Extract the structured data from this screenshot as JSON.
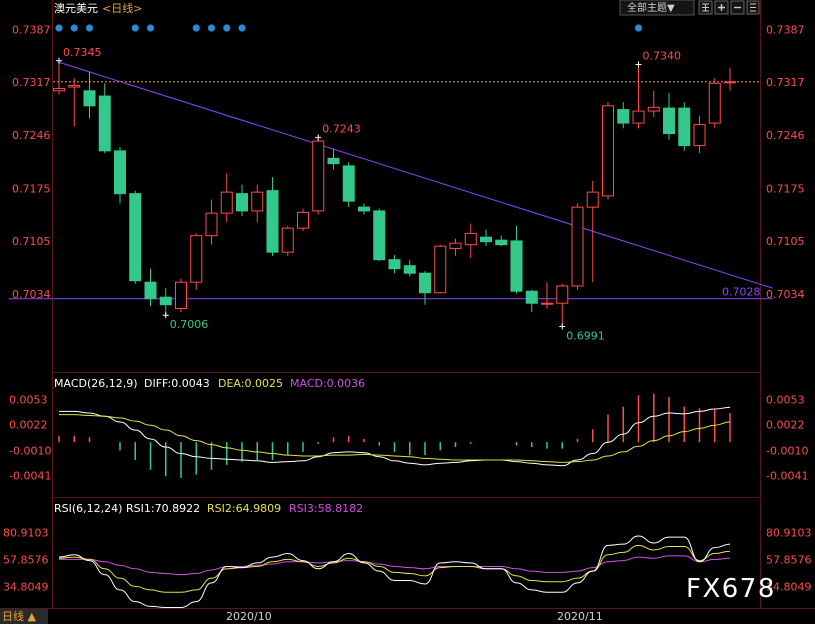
{
  "header": {
    "title": "澳元美元",
    "period": "<日线>",
    "theme_button": "全部主题▼",
    "toolbar_icons": [
      "grid-icon",
      "add-icon",
      "subtract-icon",
      "list-icon",
      "more-icon"
    ]
  },
  "colors": {
    "up": "#ff4b4b",
    "down": "#34c98c",
    "trend": "#8a44ff",
    "dot": "#2b8ad8",
    "diff": "#ffffff",
    "dea": "#e6e04a",
    "macd_label": "#d050e0",
    "rsi1": "#ffffff",
    "rsi2": "#e6e04a",
    "rsi3": "#d050e0"
  },
  "chart_data": [
    {
      "type": "candlestick",
      "title": "澳元美元<日线>",
      "ylim": [
        0.6965,
        0.7402
      ],
      "y_ticks": [
        "0.7387",
        "0.7317",
        "0.7246",
        "0.7175",
        "0.7105",
        "0.7034"
      ],
      "right_axis_ticks": [
        "0.7387",
        "0.7317",
        "0.7246",
        "0.7175",
        "0.7105",
        "0.7034"
      ],
      "last_price": "0.7317",
      "candles": [
        {
          "o": 0.7305,
          "h": 0.7345,
          "l": 0.73,
          "c": 0.7308
        },
        {
          "o": 0.731,
          "h": 0.7322,
          "l": 0.7258,
          "c": 0.7312
        },
        {
          "o": 0.7305,
          "h": 0.733,
          "l": 0.7268,
          "c": 0.7285
        },
        {
          "o": 0.7298,
          "h": 0.7315,
          "l": 0.7222,
          "c": 0.7225
        },
        {
          "o": 0.7225,
          "h": 0.723,
          "l": 0.7155,
          "c": 0.7168
        },
        {
          "o": 0.7168,
          "h": 0.7172,
          "l": 0.7048,
          "c": 0.7052
        },
        {
          "o": 0.705,
          "h": 0.7068,
          "l": 0.7018,
          "c": 0.7028
        },
        {
          "o": 0.703,
          "h": 0.7042,
          "l": 0.7006,
          "c": 0.702
        },
        {
          "o": 0.7015,
          "h": 0.7055,
          "l": 0.701,
          "c": 0.705
        },
        {
          "o": 0.705,
          "h": 0.7115,
          "l": 0.704,
          "c": 0.7112
        },
        {
          "o": 0.7112,
          "h": 0.716,
          "l": 0.71,
          "c": 0.7142
        },
        {
          "o": 0.7142,
          "h": 0.7195,
          "l": 0.713,
          "c": 0.717
        },
        {
          "o": 0.7168,
          "h": 0.718,
          "l": 0.7138,
          "c": 0.7145
        },
        {
          "o": 0.7145,
          "h": 0.718,
          "l": 0.713,
          "c": 0.717
        },
        {
          "o": 0.7172,
          "h": 0.719,
          "l": 0.7085,
          "c": 0.709
        },
        {
          "o": 0.709,
          "h": 0.7125,
          "l": 0.7085,
          "c": 0.7122
        },
        {
          "o": 0.7122,
          "h": 0.7148,
          "l": 0.7118,
          "c": 0.7143
        },
        {
          "o": 0.7145,
          "h": 0.7243,
          "l": 0.714,
          "c": 0.7238
        },
        {
          "o": 0.7215,
          "h": 0.7228,
          "l": 0.72,
          "c": 0.7208
        },
        {
          "o": 0.7205,
          "h": 0.721,
          "l": 0.715,
          "c": 0.7158
        },
        {
          "o": 0.715,
          "h": 0.7155,
          "l": 0.714,
          "c": 0.7145
        },
        {
          "o": 0.7145,
          "h": 0.7148,
          "l": 0.7078,
          "c": 0.708
        },
        {
          "o": 0.708,
          "h": 0.7086,
          "l": 0.7062,
          "c": 0.7068
        },
        {
          "o": 0.7072,
          "h": 0.708,
          "l": 0.7058,
          "c": 0.7062
        },
        {
          "o": 0.7062,
          "h": 0.7065,
          "l": 0.702,
          "c": 0.7036
        },
        {
          "o": 0.7036,
          "h": 0.71,
          "l": 0.7035,
          "c": 0.7098
        },
        {
          "o": 0.7095,
          "h": 0.7108,
          "l": 0.7085,
          "c": 0.7102
        },
        {
          "o": 0.71,
          "h": 0.7128,
          "l": 0.7082,
          "c": 0.7115
        },
        {
          "o": 0.711,
          "h": 0.712,
          "l": 0.7098,
          "c": 0.7104
        },
        {
          "o": 0.7106,
          "h": 0.7112,
          "l": 0.7098,
          "c": 0.71
        },
        {
          "o": 0.7105,
          "h": 0.7125,
          "l": 0.7035,
          "c": 0.7038
        },
        {
          "o": 0.7038,
          "h": 0.704,
          "l": 0.701,
          "c": 0.7022
        },
        {
          "o": 0.7022,
          "h": 0.705,
          "l": 0.7015,
          "c": 0.7022
        },
        {
          "o": 0.7022,
          "h": 0.7048,
          "l": 0.6991,
          "c": 0.7045
        },
        {
          "o": 0.7045,
          "h": 0.7155,
          "l": 0.704,
          "c": 0.715
        },
        {
          "o": 0.715,
          "h": 0.7185,
          "l": 0.705,
          "c": 0.717
        },
        {
          "o": 0.7165,
          "h": 0.729,
          "l": 0.716,
          "c": 0.7285
        },
        {
          "o": 0.728,
          "h": 0.729,
          "l": 0.7255,
          "c": 0.7262
        },
        {
          "o": 0.7262,
          "h": 0.734,
          "l": 0.7255,
          "c": 0.7278
        },
        {
          "o": 0.7278,
          "h": 0.7305,
          "l": 0.727,
          "c": 0.7283
        },
        {
          "o": 0.7282,
          "h": 0.7302,
          "l": 0.724,
          "c": 0.7248
        },
        {
          "o": 0.7282,
          "h": 0.729,
          "l": 0.7225,
          "c": 0.7232
        },
        {
          "o": 0.7232,
          "h": 0.7272,
          "l": 0.7222,
          "c": 0.726
        },
        {
          "o": 0.7262,
          "h": 0.7322,
          "l": 0.7255,
          "c": 0.7315
        },
        {
          "o": 0.7317,
          "h": 0.7335,
          "l": 0.7305,
          "c": 0.7317
        }
      ],
      "annotations": [
        {
          "label": "0.7345",
          "index": 0,
          "value": 0.7345,
          "kind": "high"
        },
        {
          "label": "0.7006",
          "index": 7,
          "value": 0.7006,
          "kind": "low"
        },
        {
          "label": "0.7243",
          "index": 17,
          "value": 0.7243,
          "kind": "high"
        },
        {
          "label": "0.6991",
          "index": 33,
          "value": 0.6991,
          "kind": "low"
        },
        {
          "label": "0.7340",
          "index": 38,
          "value": 0.734,
          "kind": "high"
        }
      ],
      "trendlines": [
        {
          "from": [
            0,
            0.7343
          ],
          "to": [
            46.8,
            0.7042
          ]
        },
        {
          "from": [
            -3.3,
            0.7028
          ],
          "to": [
            46.8,
            0.7028
          ],
          "label": "0.7028"
        }
      ],
      "signal_dot_indices": [
        0,
        1,
        2,
        5,
        6,
        9,
        10,
        11,
        12,
        38
      ]
    },
    {
      "type": "line",
      "title": "MACD(26,12,9)",
      "legend": [
        {
          "label": "DIFF:0.0043",
          "color_key": "diff"
        },
        {
          "label": "DEA:0.0025",
          "color_key": "dea"
        },
        {
          "label": "MACD:0.0036",
          "color_key": "macd_label"
        }
      ],
      "ylim": [
        -0.0064,
        0.0062
      ],
      "y_ticks": [
        "0.0053",
        "0.0022",
        "-0.0010",
        "-0.0041"
      ],
      "series": [
        {
          "color_key": "diff",
          "values": [
            0.0038,
            0.0038,
            0.0036,
            0.0032,
            0.0025,
            0.0015,
            0.0004,
            -0.0006,
            -0.0014,
            -0.0018,
            -0.002,
            -0.0021,
            -0.0022,
            -0.0023,
            -0.0025,
            -0.0024,
            -0.0023,
            -0.0018,
            -0.0013,
            -0.0012,
            -0.0013,
            -0.0018,
            -0.0023,
            -0.0026,
            -0.0028,
            -0.0026,
            -0.0025,
            -0.0023,
            -0.0022,
            -0.0022,
            -0.0024,
            -0.0026,
            -0.0028,
            -0.0029,
            -0.0022,
            -0.0014,
            0.0,
            0.001,
            0.0024,
            0.0032,
            0.0036,
            0.0035,
            0.0038,
            0.0041,
            0.0043
          ]
        },
        {
          "color_key": "dea",
          "values": [
            0.0034,
            0.0034,
            0.0033,
            0.0032,
            0.003,
            0.0026,
            0.0021,
            0.0015,
            0.0008,
            0.0002,
            -0.0003,
            -0.0007,
            -0.001,
            -0.0012,
            -0.0014,
            -0.0016,
            -0.0017,
            -0.0017,
            -0.0016,
            -0.0016,
            -0.0015,
            -0.0016,
            -0.0017,
            -0.0018,
            -0.002,
            -0.0021,
            -0.0022,
            -0.0022,
            -0.0022,
            -0.0022,
            -0.0022,
            -0.0023,
            -0.0024,
            -0.0025,
            -0.0024,
            -0.0022,
            -0.0017,
            -0.0012,
            -0.0005,
            0.0002,
            0.0008,
            0.0013,
            0.0017,
            0.0021,
            0.0025
          ]
        },
        {
          "name": "MACD",
          "type": "bar",
          "values": [
            0.0008,
            0.0008,
            0.0006,
            0.0,
            -0.001,
            -0.0022,
            -0.0034,
            -0.0042,
            -0.0044,
            -0.004,
            -0.0034,
            -0.0028,
            -0.0024,
            -0.0022,
            -0.0022,
            -0.0016,
            -0.0012,
            -0.0002,
            0.0006,
            0.0008,
            0.0004,
            -0.0004,
            -0.0012,
            -0.0016,
            -0.0016,
            -0.001,
            -0.0006,
            -0.0002,
            0.0,
            0.0,
            -0.0004,
            -0.0006,
            -0.0008,
            -0.0008,
            0.0004,
            0.0016,
            0.0034,
            0.0044,
            0.0058,
            0.006,
            0.0056,
            0.0044,
            0.0042,
            0.004,
            0.0036
          ]
        }
      ]
    },
    {
      "type": "line",
      "title": "RSI(6,12,24)",
      "legend": [
        {
          "label": "RSI1:70.8922",
          "color_key": "rsi1"
        },
        {
          "label": "RSI2:64.9809",
          "color_key": "rsi2"
        },
        {
          "label": "RSI3:58.8182",
          "color_key": "rsi3"
        }
      ],
      "ylim": [
        20,
        95
      ],
      "y_ticks": [
        "80.9103",
        "57.8576",
        "34.8049"
      ],
      "series": [
        {
          "color_key": "rsi1",
          "values": [
            60,
            62,
            57,
            45,
            32,
            22,
            18,
            17,
            17,
            22,
            38,
            52,
            51,
            55,
            60,
            63,
            57,
            50,
            56,
            63,
            55,
            48,
            40,
            40,
            37,
            55,
            56,
            55,
            50,
            50,
            38,
            32,
            30,
            30,
            38,
            48,
            70,
            71,
            78,
            72,
            77,
            77,
            56,
            68,
            71
          ]
        },
        {
          "color_key": "rsi2",
          "values": [
            59,
            60,
            58,
            50,
            42,
            35,
            32,
            30,
            30,
            32,
            42,
            50,
            51,
            52,
            56,
            58,
            56,
            52,
            55,
            59,
            56,
            52,
            47,
            46,
            44,
            51,
            52,
            52,
            50,
            50,
            44,
            40,
            39,
            39,
            42,
            48,
            62,
            64,
            70,
            66,
            69,
            69,
            57,
            63,
            65
          ]
        },
        {
          "color_key": "rsi3",
          "values": [
            58,
            58,
            58,
            56,
            53,
            50,
            47,
            46,
            45,
            46,
            49,
            52,
            52,
            53,
            54,
            56,
            56,
            55,
            56,
            57,
            56,
            54,
            52,
            51,
            50,
            52,
            52,
            52,
            52,
            52,
            50,
            48,
            47,
            47,
            48,
            51,
            56,
            57,
            60,
            59,
            61,
            61,
            56,
            58,
            59
          ]
        }
      ]
    }
  ],
  "x_axis": {
    "labels": [
      "2020/10",
      "2020/11"
    ]
  },
  "footer": {
    "corner_label": "日线 ▲",
    "watermark": "FX678"
  }
}
